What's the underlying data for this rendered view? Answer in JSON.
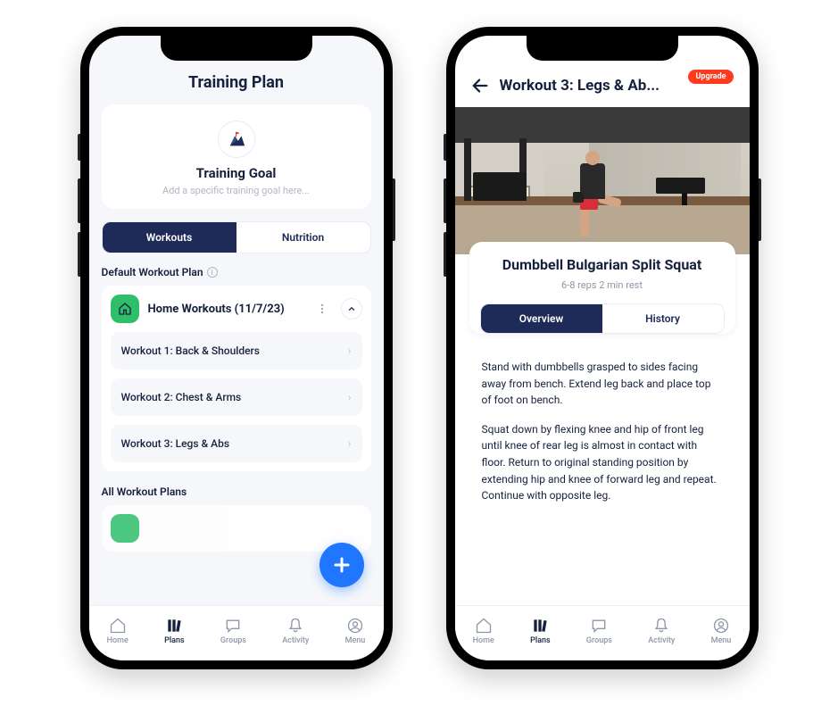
{
  "phone1": {
    "title": "Training Plan",
    "goal": {
      "heading": "Training Goal",
      "placeholder": "Add a specific training goal here..."
    },
    "tabs": {
      "workouts": "Workouts",
      "nutrition": "Nutrition",
      "active": "workouts"
    },
    "default_plan": {
      "label": "Default Workout Plan",
      "name": "Home Workouts (11/7/23)",
      "workouts": [
        "Workout 1: Back & Shoulders",
        "Workout 2: Chest & Arms",
        "Workout 3: Legs & Abs"
      ]
    },
    "all_plans": {
      "label": "All Workout Plans"
    }
  },
  "phone2": {
    "title": "Workout 3: Legs & Ab...",
    "upgrade": "Upgrade",
    "exercise": {
      "name": "Dumbbell Bulgarian Split Squat",
      "meta": "6-8 reps  2 min rest"
    },
    "tabs": {
      "overview": "Overview",
      "history": "History",
      "active": "overview"
    },
    "description": {
      "p1": "Stand with dumbbells grasped to sides facing away from bench. Extend leg back and place top of foot on bench.",
      "p2": "Squat down by flexing knee and hip of front leg until knee of rear leg is almost in contact with floor. Return to original standing position by extending hip and knee of forward leg and repeat. Continue with opposite leg."
    }
  },
  "tabbar": {
    "home": "Home",
    "plans": "Plans",
    "groups": "Groups",
    "activity": "Activity",
    "menu": "Menu",
    "active": "plans"
  }
}
